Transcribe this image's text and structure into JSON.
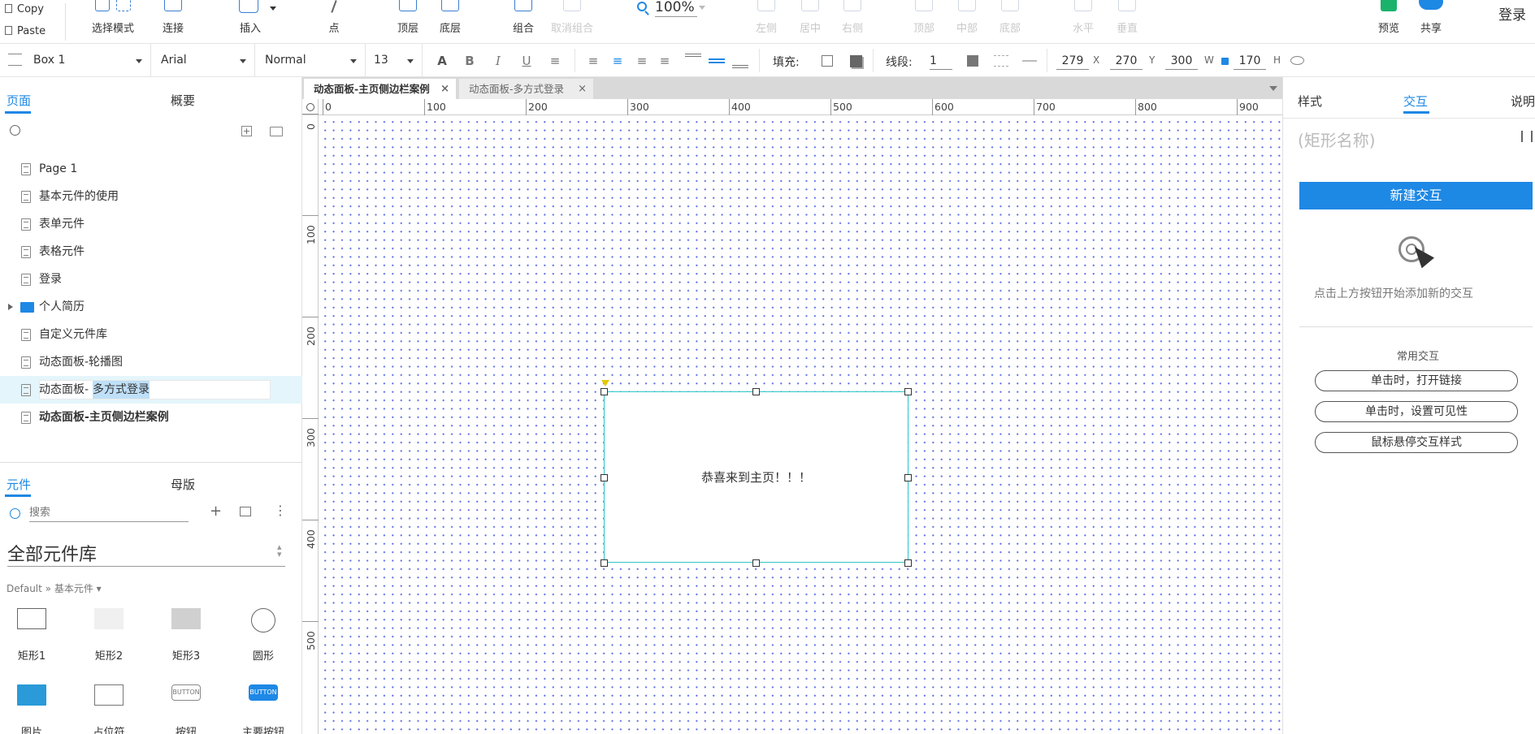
{
  "toolbar": {
    "copy": "Copy",
    "paste": "Paste",
    "select_mode": "选择模式",
    "connect": "连接",
    "insert": "插入",
    "point": "点",
    "top_layer": "顶层",
    "bottom_layer": "底层",
    "group": "组合",
    "ungroup": "取消组合",
    "zoom": "100%",
    "align_left": "左侧",
    "align_center": "居中",
    "align_right": "右侧",
    "align_top": "顶部",
    "align_middle": "中部",
    "align_bottom": "底部",
    "distribute_h": "水平",
    "distribute_v": "垂直",
    "preview": "预览",
    "share": "共享",
    "login": "登录"
  },
  "format": {
    "widget_name": "Box 1",
    "font": "Arial",
    "weight": "Normal",
    "size": "13",
    "fill_label": "填充:",
    "stroke_label": "线段:",
    "stroke_value": "1",
    "x": "279",
    "x_label": "X",
    "y": "270",
    "y_label": "Y",
    "w": "300",
    "w_label": "W",
    "h": "170",
    "h_label": "H"
  },
  "left": {
    "tab_pages": "页面",
    "tab_outline": "概要",
    "pages": [
      "Page 1",
      "基本元件的使用",
      "表单元件",
      "表格元件",
      "登录",
      "个人简历",
      "自定义元件库",
      "动态面板-轮播图",
      "动态面板-",
      "动态面板-主页侧边栏案例"
    ],
    "editing_suffix": "多方式登录",
    "tab_widgets": "元件",
    "tab_masters": "母版",
    "search_placeholder": "搜索",
    "library_title": "全部元件库",
    "library_path": "Default » 基本元件 ▾",
    "widgets": [
      "矩形1",
      "矩形2",
      "矩形3",
      "圆形",
      "图片",
      "占位符",
      "按钮",
      "主要按钮"
    ],
    "button_text": "BUTTON"
  },
  "tabs": {
    "tab1": "动态面板-主页侧边栏案例",
    "tab2": "动态面板-多方式登录",
    "close": "×"
  },
  "ruler": {
    "h": [
      "0",
      "100",
      "200",
      "300",
      "400",
      "500",
      "600",
      "700",
      "800",
      "900"
    ],
    "v": [
      "0",
      "100",
      "200",
      "300",
      "400",
      "500"
    ]
  },
  "canvas": {
    "box_text": "恭喜来到主页！！！"
  },
  "right": {
    "tab_style": "样式",
    "tab_interact": "交互",
    "tab_notes": "说明",
    "shape_name_placeholder": "(矩形名称)",
    "new_interaction": "新建交互",
    "hint": "点击上方按钮开始添加新的交互",
    "common": "常用交互",
    "quick": [
      "单击时，打开链接",
      "单击时，设置可见性",
      "鼠标悬停交互样式"
    ]
  },
  "colors": {
    "accent": "#1e88e5",
    "selection": "#2ec5c9",
    "highlight": "#e4f5fb"
  }
}
